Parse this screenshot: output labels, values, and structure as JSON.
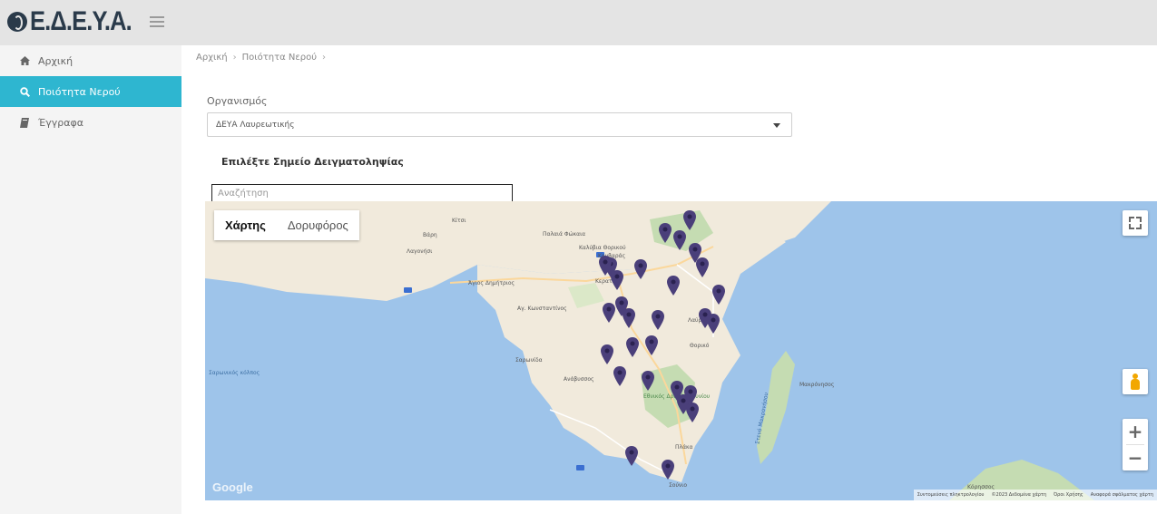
{
  "header": {
    "logo_text": "Ε.Δ.Ε.Υ.Α.",
    "logo_color": "#2a3a4a"
  },
  "sidebar": {
    "items": [
      {
        "label": "Αρχική",
        "icon": "home-icon"
      },
      {
        "label": "Ποιότητα Νερού",
        "icon": "search-icon",
        "active": true
      },
      {
        "label": "Έγγραφα",
        "icon": "book-icon"
      }
    ],
    "accent_color": "#2eb6d0"
  },
  "breadcrumb": {
    "items": [
      "Αρχική",
      "Ποιότητα Νερού"
    ]
  },
  "form": {
    "organization_label": "Οργανισμός",
    "organization_value": "ΔΕΥΑ Λαυρεωτικής",
    "section_title": "Επιλέξτε Σημείο Δειγματοληψίας",
    "search_placeholder": "Αναζήτηση"
  },
  "map": {
    "type_options": [
      "Χάρτης",
      "Δορυφόρος"
    ],
    "selected_type": "Χάρτης",
    "google_label": "Google",
    "attribution": [
      "Συντομεύσεις πληκτρολογίου",
      "©2023 Δεδομένα χάρτη",
      "Όροι Χρήσης",
      "Αναφορά σφάλματος χάρτη"
    ],
    "places": [
      {
        "name": "Κίτσι"
      },
      {
        "name": "Λαγονήσι"
      },
      {
        "name": "Βάρη"
      },
      {
        "name": "Παλαιά Φώκαια"
      },
      {
        "name": "Καλύβια Θορικού"
      },
      {
        "name": "Κουβαράς"
      },
      {
        "name": "Σαρωνίδα"
      },
      {
        "name": "Ανάβυσσος"
      },
      {
        "name": "Κερατέα"
      },
      {
        "name": "Λαύριο"
      },
      {
        "name": "Θορικό"
      },
      {
        "name": "Μακρόνησος"
      },
      {
        "name": "Σούνιο"
      },
      {
        "name": "Πλάκα"
      },
      {
        "name": "Αγ. Κωνσταντίνος"
      },
      {
        "name": "Άγιος Δημήτριος"
      },
      {
        "name": "Σαρωνικός κόλπος"
      },
      {
        "name": "Εθνικός Δρυμός Σουνίου"
      },
      {
        "name": "Κόρησσος"
      },
      {
        "name": "Στενό Μακρονήσου"
      }
    ],
    "marker_count": 28,
    "marker_color": "#4a3f7a"
  }
}
